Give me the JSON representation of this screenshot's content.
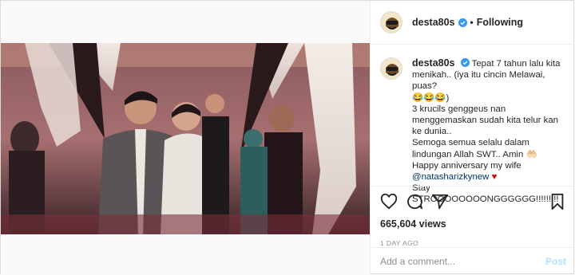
{
  "post": {
    "username": "desta80s",
    "follow_dot": "•",
    "follow_status": "Following",
    "caption": {
      "username": "desta80s",
      "lines": [
        "Tepat 7 tahun lalu kita menikah.. (iya itu cincin Melawai, puas?",
        "😂😂😂)",
        "3 krucils genggeus nan menggemaskan sudah kita telur kan ke dunia..",
        "Semoga semua selalu dalam lindungan Allah SWT.. Amin 🤲🏻",
        "Happy anniversary my wife",
        "Stay STROOOOOOOONGGGGGG!!!!!!!!!"
      ],
      "mention": "@natasharizkynew",
      "heart": "♥"
    },
    "views": "665,604 views",
    "time": "1 DAY AGO",
    "comment_placeholder": "Add a comment...",
    "post_label": "Post"
  },
  "icons": {
    "verified": "verified-badge-icon",
    "like": "heart-icon",
    "comment": "comment-bubble-icon",
    "share": "paper-plane-icon",
    "save": "bookmark-icon"
  },
  "colors": {
    "verified": "#3897f0",
    "post_button": "#b2dffc",
    "mention": "#003569",
    "heart": "#cc1111"
  }
}
